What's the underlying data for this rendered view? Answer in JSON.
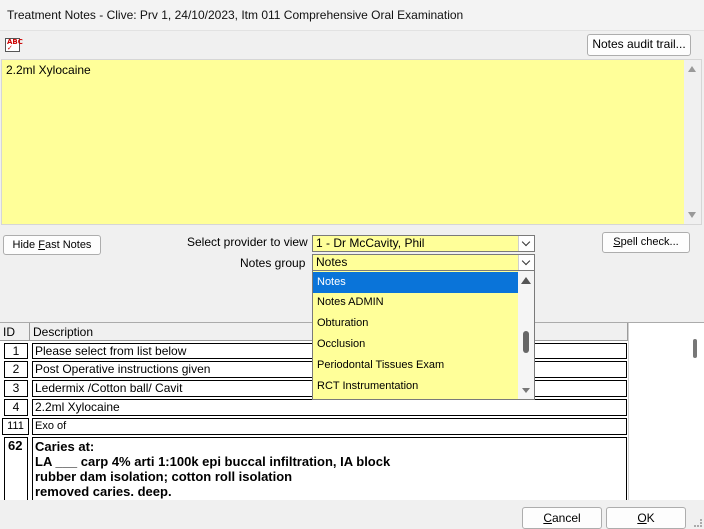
{
  "window": {
    "title": "Treatment Notes - Clive: Prv 1, 24/10/2023, Itm 011 Comprehensive Oral Examination"
  },
  "toolbar": {
    "spell_icon_top": "ABC",
    "spell_icon_bottom": "✓",
    "audit_button": "Notes audit trail..."
  },
  "notes": {
    "text": "2.2ml Xylocaine"
  },
  "controls": {
    "hide_fast_prefix": "Hide ",
    "hide_fast_accel": "F",
    "hide_fast_suffix": "ast Notes",
    "provider_label": "Select provider to view",
    "provider_value": "1 - Dr McCavity, Phil",
    "group_label": "Notes group",
    "group_value": "Notes",
    "spell_accel": "S",
    "spell_suffix": "pell check..."
  },
  "dropdown": {
    "options": [
      "Notes",
      "Notes ADMIN",
      "Obturation",
      "Occlusion",
      "Periodontal Tissues Exam",
      "RCT Instrumentation"
    ],
    "selected": "Notes"
  },
  "grid": {
    "headers": {
      "id": "ID",
      "description": "Description"
    },
    "rows": [
      {
        "id": "1",
        "desc": "Please select from list below"
      },
      {
        "id": "2",
        "desc": "Post Operative instructions given"
      },
      {
        "id": "3",
        "desc": "Ledermix /Cotton ball/ Cavit"
      },
      {
        "id": "4",
        "desc": "2.2ml Xylocaine"
      },
      {
        "id": "111",
        "desc": "Exo of"
      },
      {
        "id": "62",
        "lines": [
          "Caries at:",
          "LA ___ carp 4% arti 1:100k epi buccal infiltration, IA block",
          "rubber dam isolation; cotton roll isolation",
          "removed caries.  deep."
        ]
      }
    ]
  },
  "footer": {
    "cancel_accel": "C",
    "cancel_suffix": "ancel",
    "ok_accel": "O",
    "ok_suffix": "K"
  }
}
